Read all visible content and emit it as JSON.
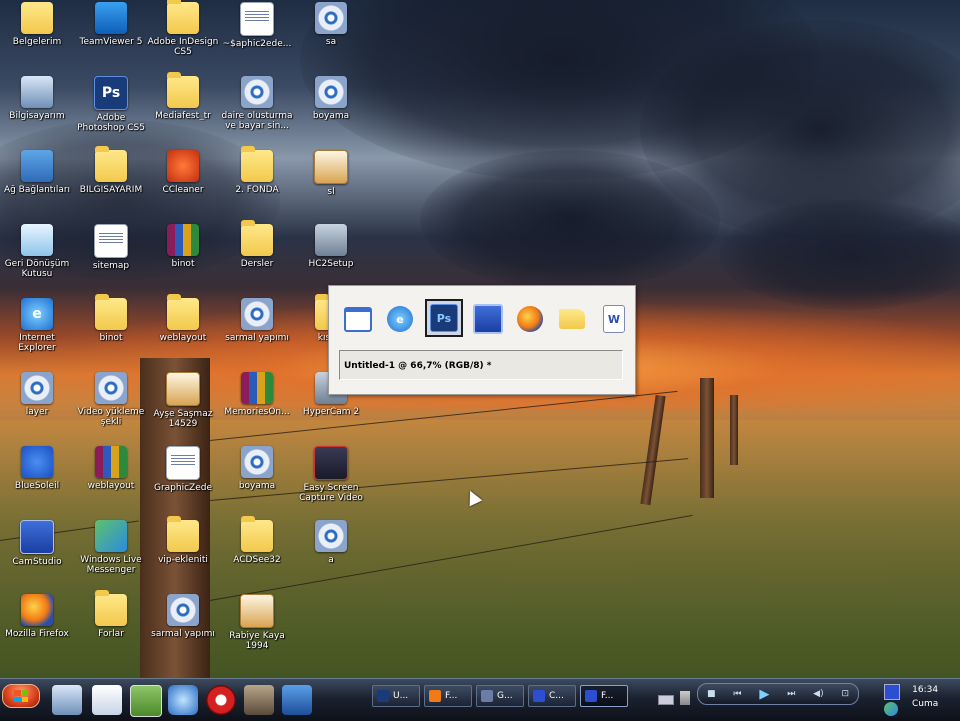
{
  "desktop": {
    "icons": [
      {
        "label": "Belgelerim",
        "icon": "documents-folder-icon"
      },
      {
        "label": "TeamViewer 5",
        "icon": "teamviewer-icon"
      },
      {
        "label": "Adobe InDesign CS5",
        "icon": "folder-icon"
      },
      {
        "label": "~$aphic2ede...",
        "icon": "document-icon"
      },
      {
        "label": "sa",
        "icon": "disc-icon"
      },
      {
        "label": "Bilgisayarım",
        "icon": "computer-icon"
      },
      {
        "label": "Adobe Photoshop CS5",
        "icon": "photoshop-icon"
      },
      {
        "label": "Mediafest_tr",
        "icon": "folder-icon"
      },
      {
        "label": "daire olusturma ve bayar sin...",
        "icon": "disc-icon"
      },
      {
        "label": "boyama",
        "icon": "disc-icon"
      },
      {
        "label": "Ağ Bağlantıları",
        "icon": "network-icon"
      },
      {
        "label": "BILGISAYARIM",
        "icon": "folder-icon"
      },
      {
        "label": "CCleaner",
        "icon": "ccleaner-icon"
      },
      {
        "label": "2. FONDA",
        "icon": "folder-icon"
      },
      {
        "label": "sl",
        "icon": "image-icon"
      },
      {
        "label": "Geri Dönüşüm Kutusu",
        "icon": "recycle-bin-icon"
      },
      {
        "label": "sitemap",
        "icon": "document-icon"
      },
      {
        "label": "binot",
        "icon": "rar-icon"
      },
      {
        "label": "Dersler",
        "icon": "folder-icon"
      },
      {
        "label": "HC2Setup",
        "icon": "camera-icon"
      },
      {
        "label": "Internet Explorer",
        "icon": "internet-explorer-icon"
      },
      {
        "label": "binot",
        "icon": "folder-icon"
      },
      {
        "label": "weblayout",
        "icon": "folder-icon"
      },
      {
        "label": "sarmal yapımı",
        "icon": "disc-icon"
      },
      {
        "label": "kısa...",
        "icon": "folder-icon"
      },
      {
        "label": "layer",
        "icon": "disc-icon"
      },
      {
        "label": "Video yükleme şekli",
        "icon": "disc-icon"
      },
      {
        "label": "Ayşe Saşmaz 14529",
        "icon": "image-icon"
      },
      {
        "label": "MemoriesOn...",
        "icon": "rar-icon"
      },
      {
        "label": "HyperCam 2",
        "icon": "camera-icon"
      },
      {
        "label": "BlueSoleil",
        "icon": "bluetooth-icon"
      },
      {
        "label": "weblayout",
        "icon": "rar-icon"
      },
      {
        "label": "GraphicZede",
        "icon": "document-icon"
      },
      {
        "label": "boyama",
        "icon": "disc-icon"
      },
      {
        "label": "Easy Screen Capture Video",
        "icon": "screen-capture-icon"
      },
      {
        "label": "CamStudio",
        "icon": "camstudio-icon"
      },
      {
        "label": "Windows Live Messenger",
        "icon": "messenger-icon"
      },
      {
        "label": "vip-ekleniti",
        "icon": "folder-icon"
      },
      {
        "label": "ACDSee32",
        "icon": "folder-icon"
      },
      {
        "label": "a",
        "icon": "disc-icon"
      },
      {
        "label": "Mozilla Firefox",
        "icon": "firefox-icon"
      },
      {
        "label": "Forlar",
        "icon": "folder-icon"
      },
      {
        "label": "sarmal yapımı",
        "icon": "disc-icon"
      },
      {
        "label": "Rabiye Kaya 1994",
        "icon": "image-icon"
      }
    ]
  },
  "switcher": {
    "items": [
      {
        "icon": "window-icon",
        "selected": false
      },
      {
        "icon": "internet-explorer-icon",
        "selected": false
      },
      {
        "icon": "photoshop-icon",
        "selected": true,
        "glyph": "Ps"
      },
      {
        "icon": "camstudio-icon",
        "selected": false
      },
      {
        "icon": "firefox-icon",
        "selected": false
      },
      {
        "icon": "folder-icon",
        "selected": false
      },
      {
        "icon": "word-document-icon",
        "selected": false
      }
    ],
    "title": "Untitled-1 @ 66,7% (RGB/8) *"
  },
  "taskbar": {
    "tasks": [
      {
        "label": "U...",
        "icon": "photoshop-icon",
        "color": "#1a3b7a"
      },
      {
        "label": "F...",
        "icon": "firefox-icon",
        "color": "#f07a15"
      },
      {
        "label": "G...",
        "icon": "document-icon",
        "color": "#6b7da6"
      },
      {
        "label": "C...",
        "icon": "camstudio-icon",
        "color": "#2b4fd0"
      },
      {
        "label": "F...",
        "icon": "camstudio-icon",
        "color": "#2b4fd0"
      }
    ],
    "clock": {
      "time": "16:34",
      "day": "Cuma"
    }
  }
}
